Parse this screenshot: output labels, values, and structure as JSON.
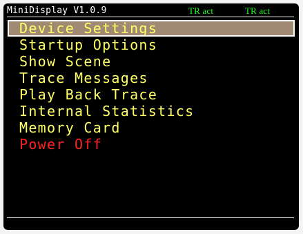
{
  "window": {
    "title": "MiniDisplay V1.0.9",
    "status_1": "TR act",
    "status_2": "TR act"
  },
  "menu": {
    "items": [
      {
        "label": "Device Settings",
        "selected": true
      },
      {
        "label": "Startup Options",
        "selected": false
      },
      {
        "label": "Show Scene",
        "selected": false
      },
      {
        "label": "Trace Messages",
        "selected": false
      },
      {
        "label": "Play Back Trace",
        "selected": false
      },
      {
        "label": "Internal Statistics",
        "selected": false
      },
      {
        "label": "Memory Card",
        "selected": false
      },
      {
        "label": "Power Off",
        "selected": false
      }
    ]
  },
  "colors": {
    "background": "#000000",
    "menu_text": "#ffff66",
    "power_text": "#ff2222",
    "status_text": "#22ff22",
    "selection_bg": "#a08a73"
  }
}
